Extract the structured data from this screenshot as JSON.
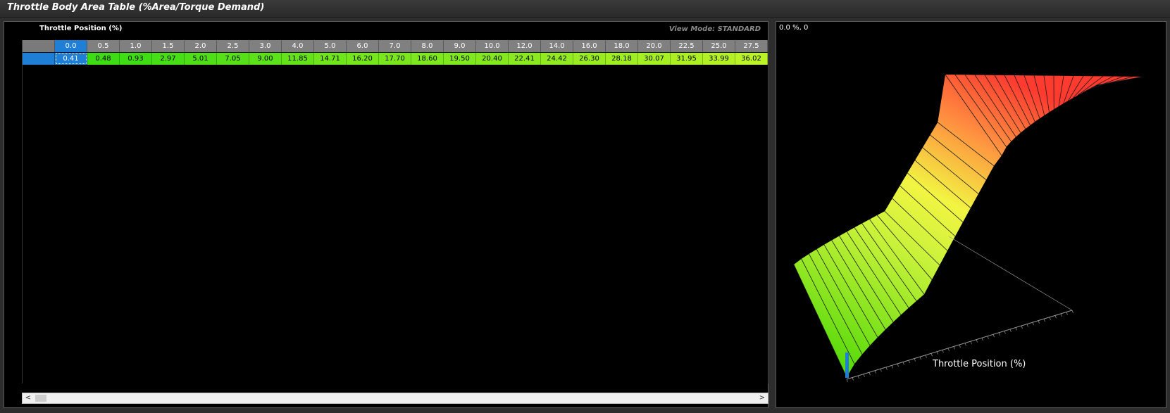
{
  "window": {
    "title": "Throttle Body Area Table (%Area/Torque Demand)"
  },
  "table": {
    "axis_label": "Throttle Position (%)",
    "view_mode": "View Mode: STANDARD",
    "selected_index": 0,
    "columns": [
      "0.0",
      "0.5",
      "1.0",
      "1.5",
      "2.0",
      "2.5",
      "3.0",
      "4.0",
      "5.0",
      "6.0",
      "7.0",
      "8.0",
      "9.0",
      "10.0",
      "12.0",
      "14.0",
      "16.0",
      "18.0",
      "20.0",
      "22.5",
      "25.0",
      "27.5"
    ],
    "values": [
      "0.41",
      "0.48",
      "0.93",
      "2.97",
      "5.01",
      "7.05",
      "9.00",
      "11.85",
      "14.71",
      "16.20",
      "17.70",
      "18.60",
      "19.50",
      "20.40",
      "22.41",
      "24.42",
      "26.30",
      "28.18",
      "30.07",
      "31.95",
      "33.99",
      "36.02"
    ]
  },
  "scrollbar": {
    "left_arrow": "<",
    "right_arrow": ">"
  },
  "graph": {
    "coord_readout": "0.0 %, 0",
    "x_axis_title": "Throttle Position (%)",
    "colors": {
      "low": "#3cd400",
      "mid": "#f2f542",
      "high": "#ff3b30",
      "axis": "#9a9a9a",
      "cursor": "#1f7fd6"
    }
  }
}
